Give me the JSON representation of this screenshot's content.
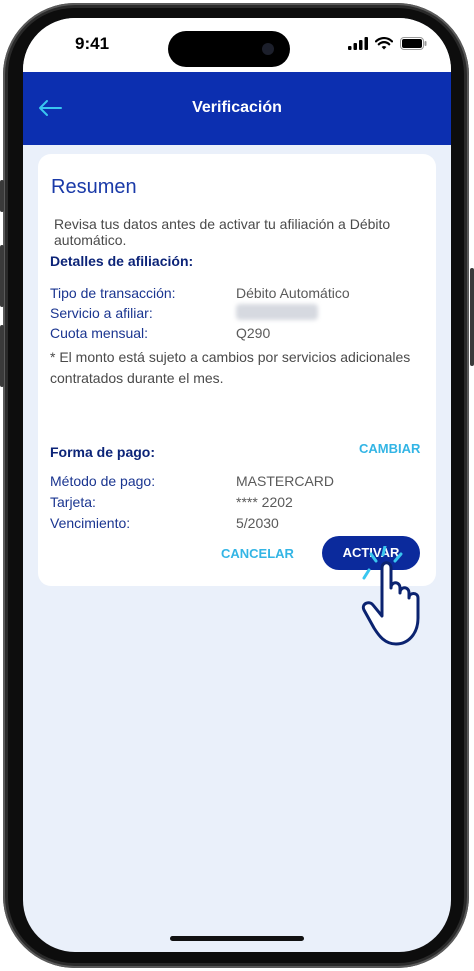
{
  "status": {
    "time": "9:41"
  },
  "appbar": {
    "title": "Verificación"
  },
  "card": {
    "title": "Resumen",
    "intro": "Revisa tus datos antes de activar tu afiliación a Débito automático.",
    "details_heading": "Detalles de afiliación:",
    "details": [
      {
        "label": "Tipo de transacción:",
        "value": "Débito Automático"
      },
      {
        "label": "Servicio a afiliar:",
        "value": ""
      },
      {
        "label": "Cuota mensual:",
        "value": "Q290"
      }
    ],
    "note": "* El monto está sujeto a cambios por servicios adicionales contratados durante el mes.",
    "payment_heading": "Forma de pago:",
    "change_label": "CAMBIAR",
    "payment": [
      {
        "label": "Método de pago:",
        "value": "MASTERCARD"
      },
      {
        "label": "Tarjeta:",
        "value": "**** 2202"
      },
      {
        "label": "Vencimiento:",
        "value": "5/2030"
      }
    ],
    "cancel_label": "CANCELAR",
    "activate_label": "ACTIVAR"
  },
  "colors": {
    "brand": "#0c2fb0",
    "accent": "#33b5e5",
    "label": "#1a3590"
  },
  "icons": {
    "back": "arrow-left-icon",
    "hand": "pointing-hand-icon"
  }
}
